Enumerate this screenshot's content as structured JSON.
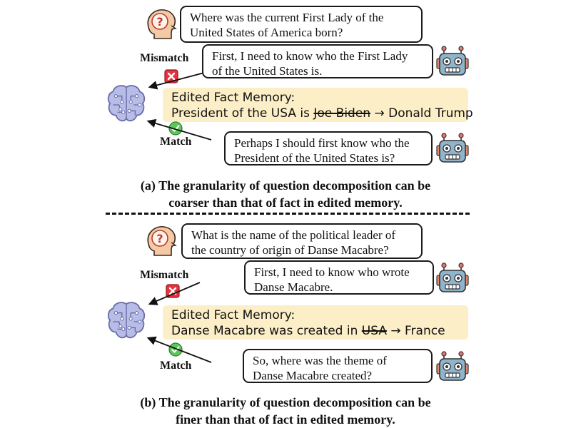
{
  "panel_a": {
    "question": [
      "Where was the current First Lady of the",
      "United States of America born?"
    ],
    "bad_subq": [
      "First, I need to know who the First Lady",
      "of the United States is."
    ],
    "memory_title": "Edited Fact Memory:",
    "memory_prefix": "President of the USA is ",
    "memory_old": "Joe Biden",
    "memory_arrow": " → ",
    "memory_new": "Donald Trump",
    "good_subq": [
      "Perhaps I should first know who the",
      "President of the United States is?"
    ],
    "mismatch_label": "Mismatch",
    "match_label": "Match",
    "caption": [
      "(a) The granularity of question decomposition can be",
      "coarser than that of fact in edited memory."
    ]
  },
  "panel_b": {
    "question": [
      "What is the name of the political leader of",
      "the country of origin of Danse Macabre?"
    ],
    "bad_subq": [
      "First, I need to know who wrote",
      "Danse Macabre."
    ],
    "memory_title": "Edited Fact Memory:",
    "memory_prefix": "Danse Macabre was created in ",
    "memory_old": "USA",
    "memory_arrow": " → ",
    "memory_new": "France",
    "good_subq": [
      "So, where was the theme of",
      "Danse Macabre created?"
    ],
    "mismatch_label": "Mismatch",
    "match_label": "Match",
    "caption": [
      "(b) The granularity of question decomposition can be",
      "finer than that of fact in edited memory."
    ]
  },
  "colors": {
    "memory_bg": "#fcefc7",
    "head_skin": "#f3c9a6",
    "question_mark": "#c0392b",
    "brain": "#b8bde8",
    "robot_body": "#8fb4cc",
    "mismatch_red": "#e8323c",
    "match_green": "#5cc85a"
  },
  "icons": [
    "question-head-icon",
    "robot-icon",
    "brain-icon",
    "mismatch-cross-icon",
    "match-check-icon"
  ]
}
